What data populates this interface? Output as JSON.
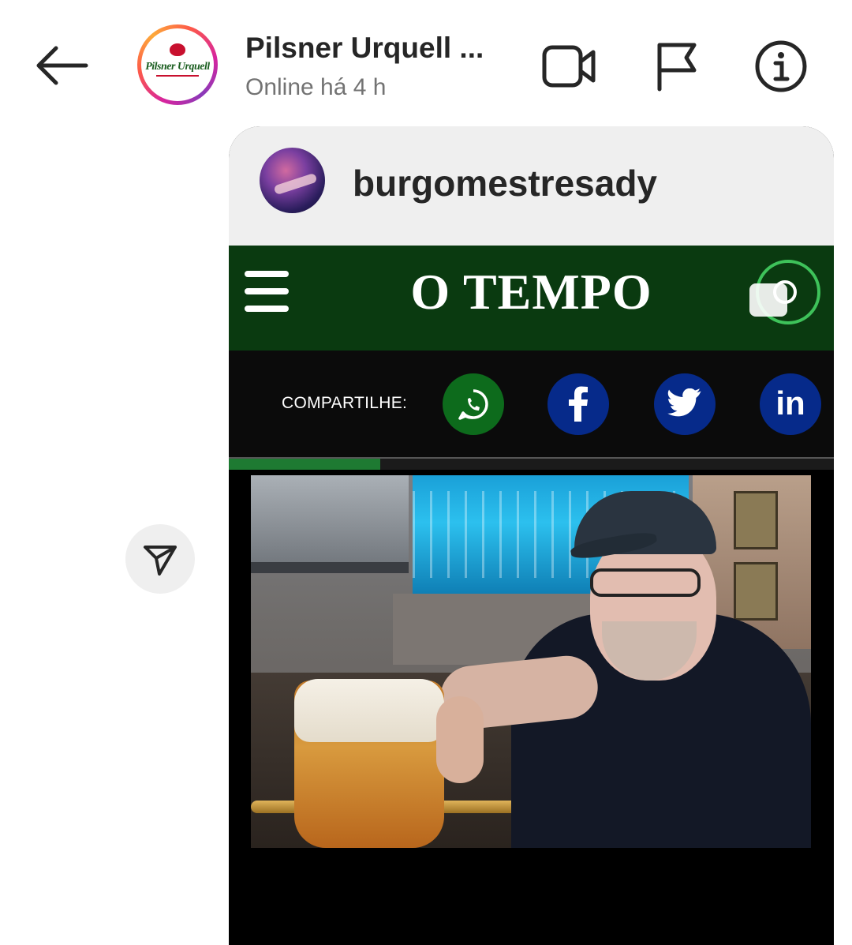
{
  "header": {
    "back_label": "Back",
    "chat_name": "Pilsner Urquell ...",
    "status": "Online há 4 h",
    "avatar_brand": "Pilsner Urquell",
    "icons": {
      "back": "arrow-left-icon",
      "video": "video-call-icon",
      "flag": "flag-icon",
      "info": "info-icon"
    }
  },
  "shared_post": {
    "username": "burgomestresady",
    "site": {
      "logo_text": "O TEMPO",
      "share_label": "COMPARTILHE:",
      "share_buttons": [
        {
          "name": "whatsapp",
          "icon": "whatsapp-icon",
          "color": "#0d6b1c"
        },
        {
          "name": "facebook",
          "icon": "facebook-icon",
          "color": "#062a8a"
        },
        {
          "name": "twitter",
          "icon": "twitter-icon",
          "color": "#062a8a"
        },
        {
          "name": "linkedin",
          "icon": "linkedin-icon",
          "color": "#062a8a",
          "text": "in"
        }
      ],
      "progress_fraction": 0.25,
      "header_color": "#0a3a10"
    },
    "photo_description_icon": "photo-man-with-beer"
  },
  "actions": {
    "share_icon": "send-icon"
  },
  "colors": {
    "accent_green": "#1e7a32",
    "text_primary": "#262626",
    "text_secondary": "#737373"
  }
}
